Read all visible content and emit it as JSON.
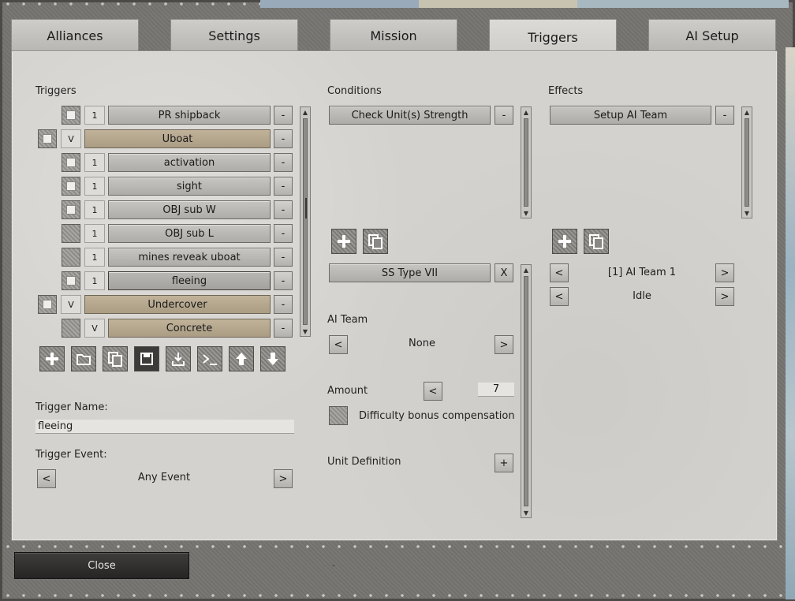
{
  "tabs": [
    "Alliances",
    "Settings",
    "Mission",
    "Triggers",
    "AI Setup"
  ],
  "active_tab": "Triggers",
  "triggers": {
    "label": "Triggers",
    "items": [
      {
        "count": "1",
        "label": "PR shipback",
        "style": "grey",
        "indent": true,
        "check": "on"
      },
      {
        "count": "V",
        "label": "Uboat",
        "style": "tan",
        "indent": false,
        "check": "on"
      },
      {
        "count": "1",
        "label": "activation",
        "style": "grey",
        "indent": true,
        "check": "on"
      },
      {
        "count": "1",
        "label": "sight",
        "style": "grey",
        "indent": true,
        "check": "on"
      },
      {
        "count": "1",
        "label": "OBJ sub W",
        "style": "grey",
        "indent": true,
        "check": "on"
      },
      {
        "count": "1",
        "label": "OBJ sub L",
        "style": "grey",
        "indent": true,
        "check": "off"
      },
      {
        "count": "1",
        "label": "mines reveak uboat",
        "style": "grey",
        "indent": true,
        "check": "off"
      },
      {
        "count": "1",
        "label": "fleeing",
        "style": "grey-selected",
        "indent": true,
        "check": "on"
      },
      {
        "count": "V",
        "label": "Undercover",
        "style": "tan",
        "indent": false,
        "check": "on"
      },
      {
        "count": "V",
        "label": "Concrete",
        "style": "tan",
        "indent": true,
        "check": "off"
      }
    ],
    "remove_label": "-"
  },
  "toolbar_icons": [
    "add-icon",
    "folder-icon",
    "copy-icon",
    "save-icon",
    "import-icon",
    "console-icon",
    "move-up-icon",
    "move-down-icon"
  ],
  "trigger_name": {
    "label": "Trigger Name:",
    "value": "fleeing"
  },
  "trigger_event": {
    "label": "Trigger Event:",
    "value": "Any Event",
    "prev": "<",
    "next": ">"
  },
  "conditions": {
    "label": "Conditions",
    "items": [
      {
        "label": "Check Unit(s) Strength",
        "remove": "-"
      }
    ],
    "unit_entry": {
      "label": "SS Type VII",
      "remove": "X"
    },
    "ai_team": {
      "label": "AI Team",
      "value": "None",
      "prev": "<",
      "next": ">"
    },
    "amount": {
      "label": "Amount",
      "prev": "<",
      "value": "7"
    },
    "difficulty": {
      "label": "Difficulty bonus compensation"
    },
    "unit_definition": {
      "label": "Unit Definition",
      "add": "+"
    }
  },
  "effects": {
    "label": "Effects",
    "items": [
      {
        "label": "Setup AI Team",
        "remove": "-"
      }
    ],
    "team_selector": {
      "value": "[1] AI Team 1",
      "prev": "<",
      "next": ">"
    },
    "mode_selector": {
      "value": "Idle",
      "prev": "<",
      "next": ">"
    }
  },
  "footer": {
    "close_label": "Close",
    "dash": "-"
  }
}
